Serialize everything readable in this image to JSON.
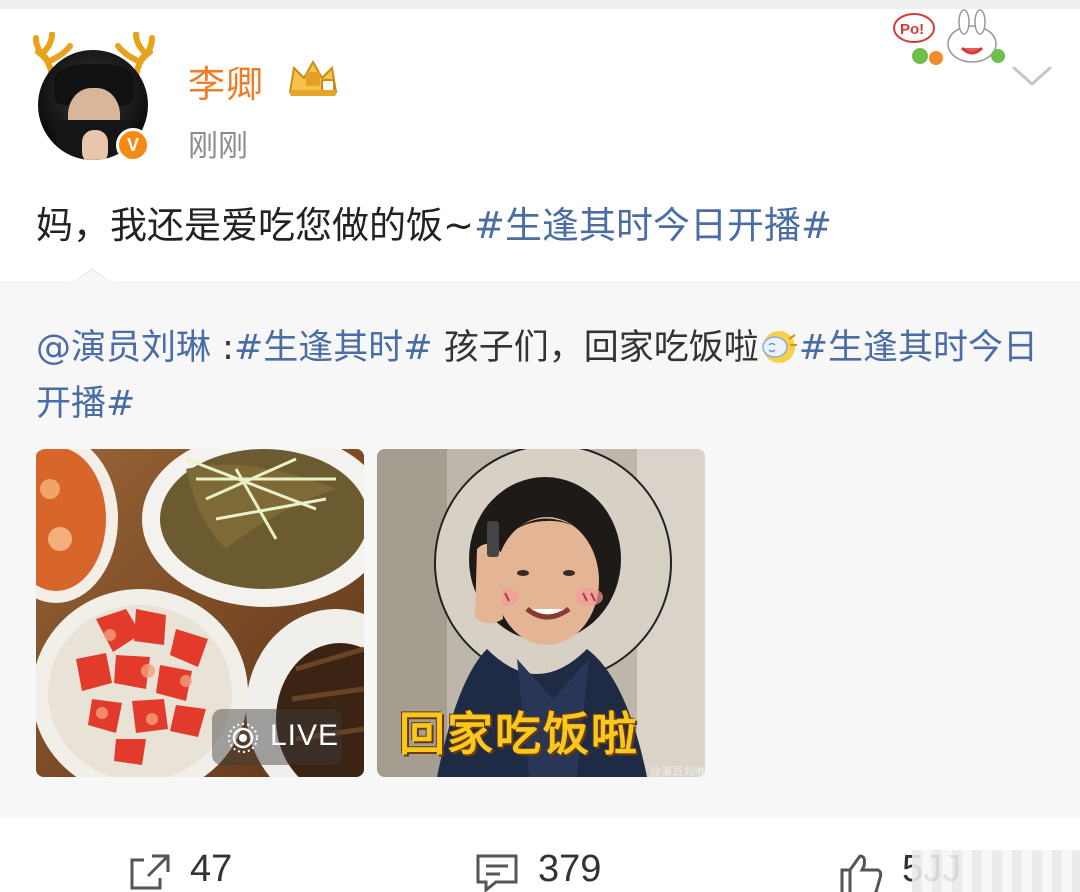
{
  "post": {
    "author": "李卿",
    "time": "刚刚",
    "text_plain": "妈，我还是爱吃您做的饭~",
    "text_hashtag": "#生逢其时今日开播#"
  },
  "repost": {
    "mention": "@演员刘琳",
    "sep": " :",
    "hashtag1": "#生逢其时#",
    "text": " 孩子们，回家吃饭啦",
    "hashtag2": "#生逢其时今日开播#",
    "images": [
      {
        "name": "food-photo",
        "badge": "LIVE"
      },
      {
        "name": "mom-photo",
        "caption": "回家吃饭啦",
        "watermark": "@演员刘琳"
      }
    ]
  },
  "actions": {
    "share_count": "47",
    "comment_count": "379",
    "like_count": "5JJ"
  },
  "icons": {
    "verified": "verified-v-icon",
    "member": "crown-member-icon",
    "menu": "chevron-down-icon",
    "share": "share-icon",
    "comment": "comment-icon",
    "like": "thumbs-up-icon",
    "live": "live-icon"
  },
  "colors": {
    "username": "#f07d25",
    "link": "#4b6da6",
    "verified": "#f78a13",
    "repost_bg": "#f7f7f7"
  }
}
